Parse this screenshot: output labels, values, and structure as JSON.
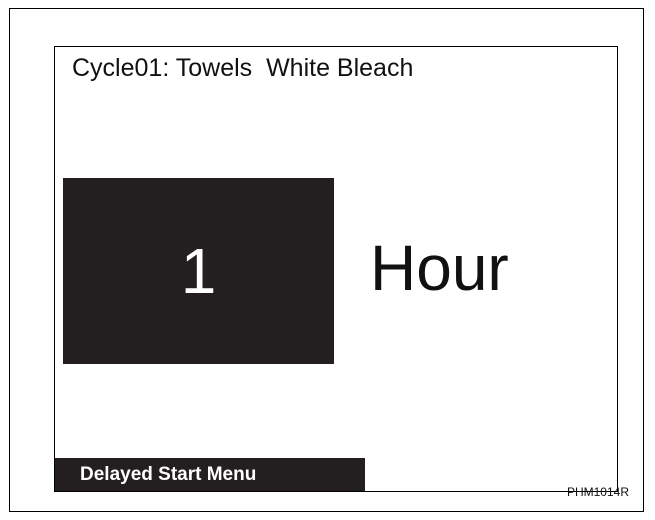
{
  "display": {
    "cycle_title": "Cycle01: Towels  White Bleach",
    "delay_value": "1",
    "delay_unit": "Hour",
    "menu_label": "Delayed Start Menu"
  },
  "figure": {
    "code": "PHM1014R"
  },
  "colors": {
    "screen_background": "#ffffff",
    "highlight_fill": "#231f20",
    "text": "#111111"
  }
}
